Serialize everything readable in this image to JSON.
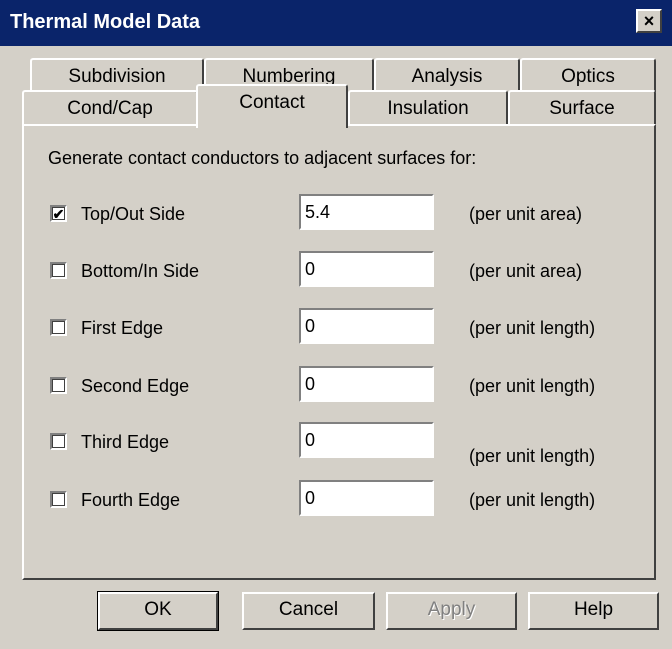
{
  "window": {
    "title": "Thermal Model Data",
    "close_label": "×"
  },
  "tabs_back": [
    {
      "label": "Subdivision"
    },
    {
      "label": "Numbering"
    },
    {
      "label": "Analysis"
    },
    {
      "label": "Optics"
    }
  ],
  "tabs_front": [
    {
      "label": "Cond/Cap"
    },
    {
      "label": "Contact"
    },
    {
      "label": "Insulation"
    },
    {
      "label": "Surface"
    }
  ],
  "active_tab": "Contact",
  "panel": {
    "heading": "Generate contact conductors to adjacent surfaces for:",
    "rows": [
      {
        "label": "Top/Out Side",
        "checked": true,
        "check_mark": "✔",
        "value": "5.4",
        "unit": "(per unit area)"
      },
      {
        "label": "Bottom/In Side",
        "checked": false,
        "check_mark": "",
        "value": "0",
        "unit": "(per unit area)"
      },
      {
        "label": "First Edge",
        "checked": false,
        "check_mark": "",
        "value": "0",
        "unit": "(per unit length)"
      },
      {
        "label": "Second Edge",
        "checked": false,
        "check_mark": "",
        "value": "0",
        "unit": "(per unit length)"
      },
      {
        "label": "Third Edge",
        "checked": false,
        "check_mark": "",
        "value": "0",
        "unit": "(per unit length)"
      },
      {
        "label": "Fourth Edge",
        "checked": false,
        "check_mark": "",
        "value": "0",
        "unit": "(per unit length)"
      }
    ]
  },
  "buttons": {
    "ok": "OK",
    "cancel": "Cancel",
    "apply": "Apply",
    "help": "Help"
  },
  "colors": {
    "title_bar": "#0a246a",
    "face": "#d4d0c8",
    "disabled_text": "#808080"
  }
}
